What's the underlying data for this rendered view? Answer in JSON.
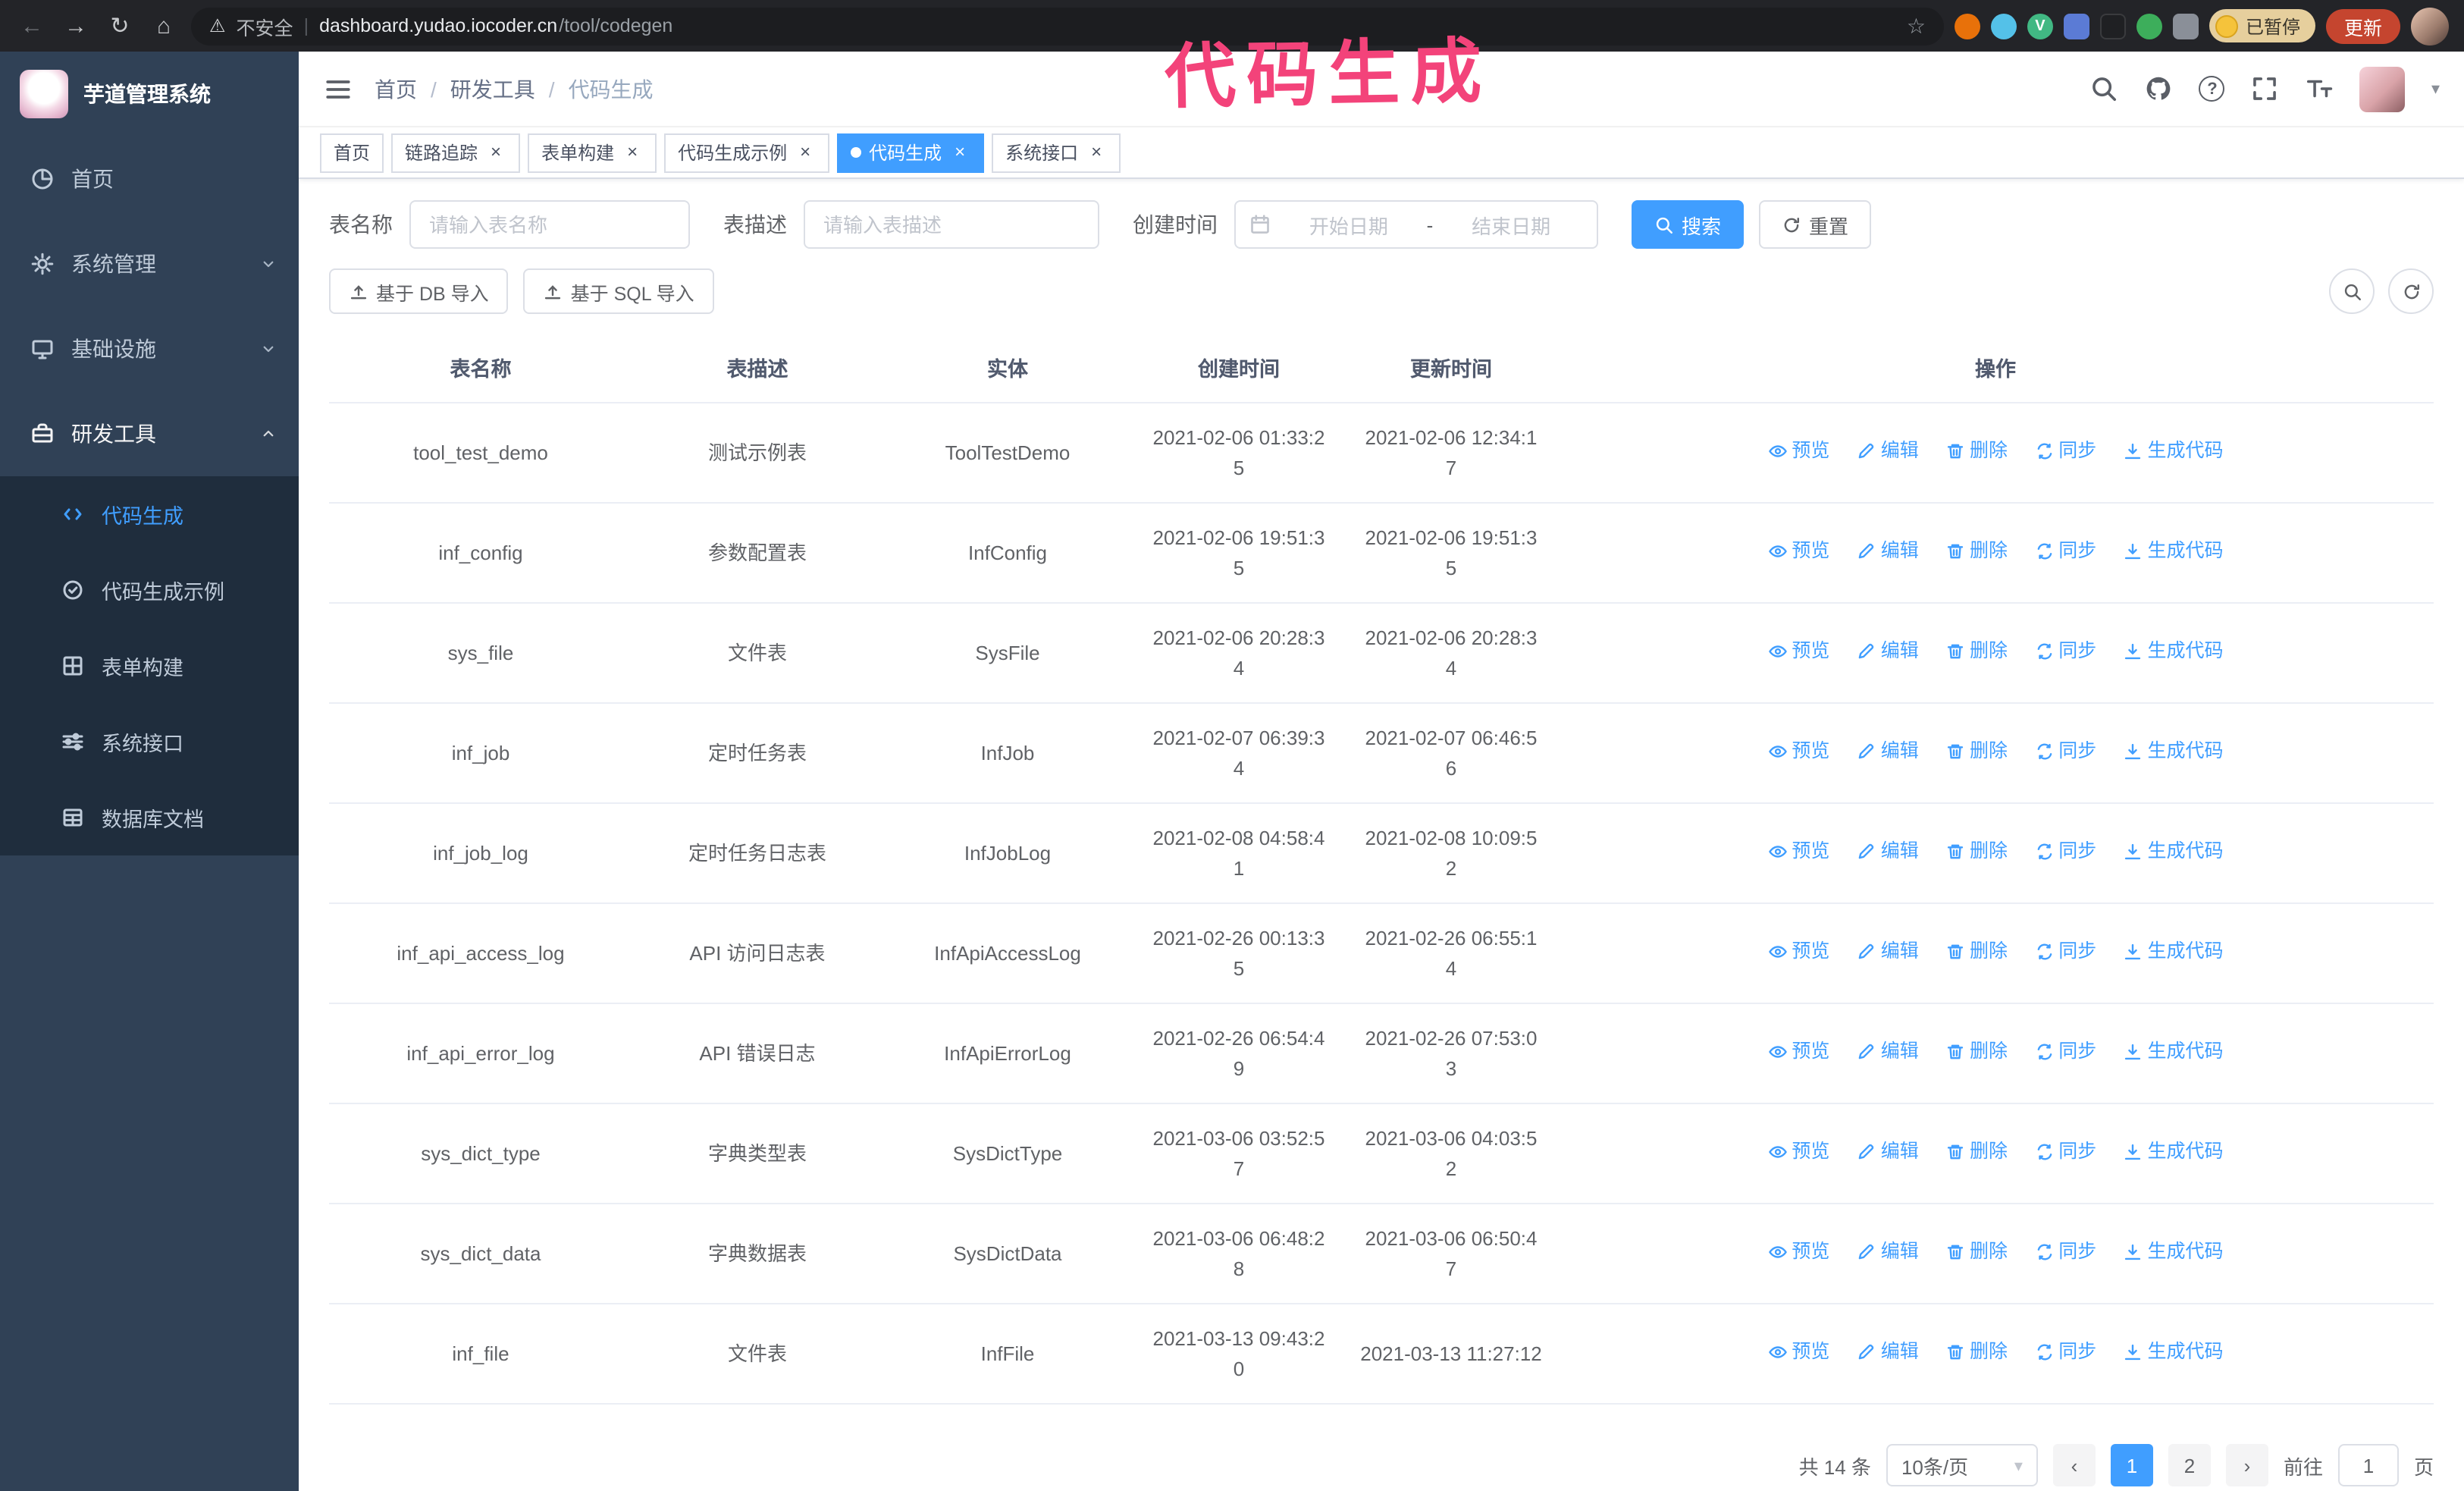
{
  "colors": {
    "accent": "#409eff",
    "annotation_pink": "#f3437a",
    "sidebar_bg": "#304156",
    "submenu_bg": "#1f2d3d"
  },
  "annotation": {
    "text": "代码生成"
  },
  "browser": {
    "security_label": "不安全",
    "url_host": "dashboard.yudao.iocoder.cn",
    "url_path": "/tool/codegen",
    "vue_letter": "V",
    "paused_badge": "已暂停",
    "update_button": "更新"
  },
  "glyphs": {
    "back": "←",
    "forward": "→",
    "reload": "↻",
    "home": "⌂",
    "warning": "⚠",
    "divider": "|",
    "star": "☆",
    "close": "×",
    "caret_down": "▾",
    "breadcrumb_separator": "/",
    "question": "?",
    "prev": "‹",
    "next": "›",
    "range_separator": "-"
  },
  "sidebar": {
    "logo_title": "芋道管理系统",
    "items": [
      {
        "label": "首页"
      },
      {
        "label": "系统管理"
      },
      {
        "label": "基础设施"
      },
      {
        "label": "研发工具"
      }
    ],
    "submenu": [
      {
        "label": "代码生成"
      },
      {
        "label": "代码生成示例"
      },
      {
        "label": "表单构建"
      },
      {
        "label": "系统接口"
      },
      {
        "label": "数据库文档"
      }
    ]
  },
  "breadcrumb": [
    "首页",
    "研发工具",
    "代码生成"
  ],
  "tabs": [
    {
      "label": "首页"
    },
    {
      "label": "链路追踪"
    },
    {
      "label": "表单构建"
    },
    {
      "label": "代码生成示例"
    },
    {
      "label": "代码生成"
    },
    {
      "label": "系统接口"
    }
  ],
  "filters": {
    "table_name_label": "表名称",
    "table_name_placeholder": "请输入表名称",
    "table_desc_label": "表描述",
    "table_desc_placeholder": "请输入表描述",
    "create_time_label": "创建时间",
    "date_start_placeholder": "开始日期",
    "date_end_placeholder": "结束日期",
    "search_button": "搜索",
    "reset_button": "重置"
  },
  "toolbar": {
    "import_db_button": "基于 DB 导入",
    "import_sql_button": "基于 SQL 导入"
  },
  "table": {
    "columns": [
      "表名称",
      "表描述",
      "实体",
      "创建时间",
      "更新时间",
      "操作"
    ],
    "row_actions": [
      "预览",
      "编辑",
      "删除",
      "同步",
      "生成代码"
    ],
    "rows": [
      {
        "name": "tool_test_demo",
        "desc": "测试示例表",
        "entity": "ToolTestDemo",
        "create_time": "2021-02-06 01:33:25",
        "update_time": "2021-02-06 12:34:17"
      },
      {
        "name": "inf_config",
        "desc": "参数配置表",
        "entity": "InfConfig",
        "create_time": "2021-02-06 19:51:35",
        "update_time": "2021-02-06 19:51:35"
      },
      {
        "name": "sys_file",
        "desc": "文件表",
        "entity": "SysFile",
        "create_time": "2021-02-06 20:28:34",
        "update_time": "2021-02-06 20:28:34"
      },
      {
        "name": "inf_job",
        "desc": "定时任务表",
        "entity": "InfJob",
        "create_time": "2021-02-07 06:39:34",
        "update_time": "2021-02-07 06:46:56"
      },
      {
        "name": "inf_job_log",
        "desc": "定时任务日志表",
        "entity": "InfJobLog",
        "create_time": "2021-02-08 04:58:41",
        "update_time": "2021-02-08 10:09:52"
      },
      {
        "name": "inf_api_access_log",
        "desc": "API 访问日志表",
        "entity": "InfApiAccessLog",
        "create_time": "2021-02-26 00:13:35",
        "update_time": "2021-02-26 06:55:14"
      },
      {
        "name": "inf_api_error_log",
        "desc": "API 错误日志",
        "entity": "InfApiErrorLog",
        "create_time": "2021-02-26 06:54:49",
        "update_time": "2021-02-26 07:53:03"
      },
      {
        "name": "sys_dict_type",
        "desc": "字典类型表",
        "entity": "SysDictType",
        "create_time": "2021-03-06 03:52:57",
        "update_time": "2021-03-06 04:03:52"
      },
      {
        "name": "sys_dict_data",
        "desc": "字典数据表",
        "entity": "SysDictData",
        "create_time": "2021-03-06 06:48:28",
        "update_time": "2021-03-06 06:50:47"
      },
      {
        "name": "inf_file",
        "desc": "文件表",
        "entity": "InfFile",
        "create_time": "2021-03-13 09:43:20",
        "update_time": "2021-03-13 11:27:12"
      }
    ]
  },
  "pagination": {
    "total_text": "共 14 条",
    "page_size": "10条/页",
    "pages": [
      "1",
      "2"
    ],
    "active_page": "1",
    "goto_label": "前往",
    "goto_value": "1",
    "goto_unit": "页"
  }
}
